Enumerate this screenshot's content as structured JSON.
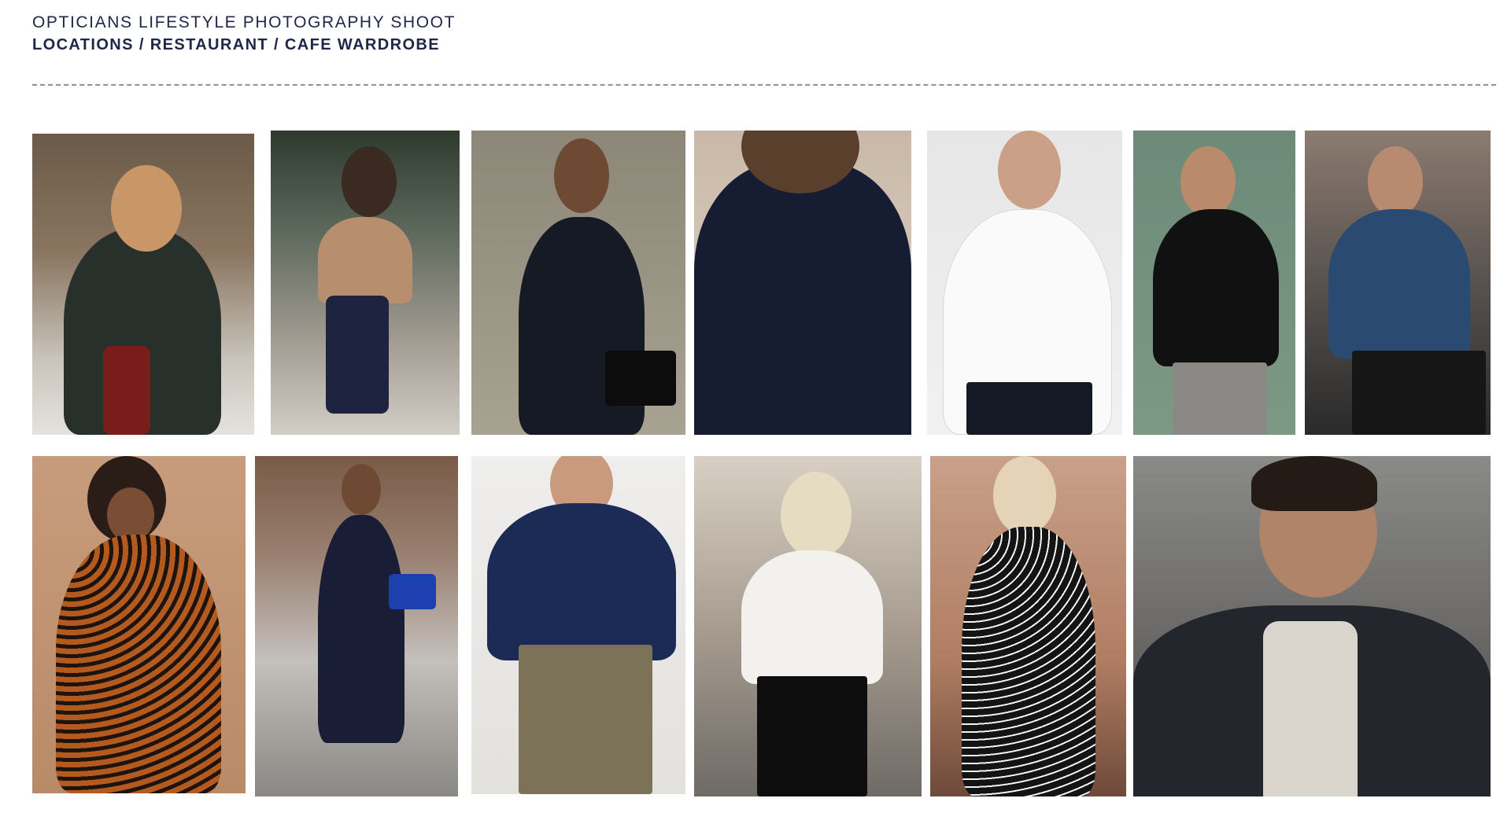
{
  "header": {
    "subtitle": "OPTICIANS LIFESTYLE PHOTOGRAPHY SHOOT",
    "title": "LOCATIONS / RESTAURANT / CAFE WARDROBE"
  },
  "colors": {
    "text": "#1f2647",
    "divider": "#8b90a8",
    "background": "#ffffff"
  }
}
